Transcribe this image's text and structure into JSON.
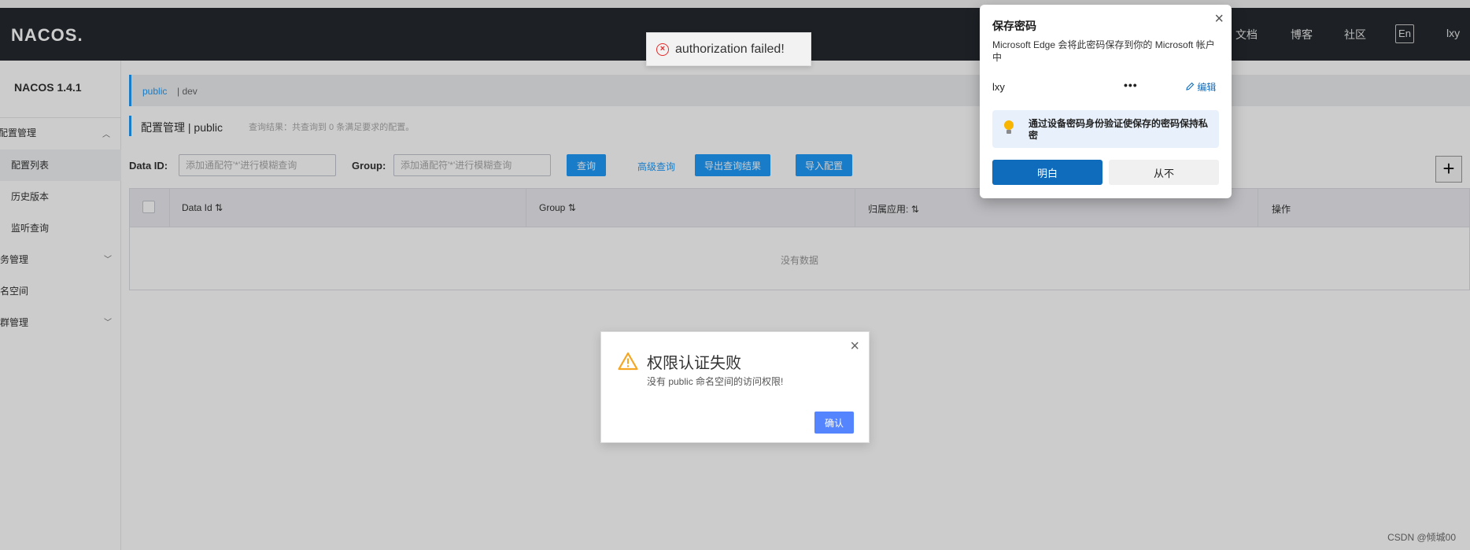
{
  "header": {
    "logo": "NACOS.",
    "nav": [
      "文档",
      "博客",
      "社区"
    ],
    "lang": "En",
    "user": "lxy"
  },
  "sidebar": {
    "title": "NACOS 1.4.1",
    "items": [
      {
        "label": "配置管理"
      },
      {
        "label": "配置列表"
      },
      {
        "label": "历史版本"
      },
      {
        "label": "监听查询"
      },
      {
        "label": "服务管理"
      },
      {
        "label": "命名空间"
      },
      {
        "label": "集群管理"
      }
    ]
  },
  "namespace": {
    "active": "public",
    "other": "| dev"
  },
  "page": {
    "title": "配置管理 | public",
    "query_tip": "查询结果：共查询到 0 条满足要求的配置。"
  },
  "filters": {
    "data_id_label": "Data ID:",
    "data_id_placeholder": "添加通配符'*'进行模糊查询",
    "group_label": "Group:",
    "group_placeholder": "添加通配符'*'进行模糊查询",
    "query_button": "查询",
    "advanced_query": "高级查询",
    "export_button": "导出查询结果",
    "import_button": "导入配置",
    "add_button": "+"
  },
  "table": {
    "columns": [
      "Data Id",
      "Group",
      "归属应用:",
      "操作"
    ],
    "sort_icon": "⇅",
    "empty": "没有数据"
  },
  "toast": {
    "message": "authorization failed!"
  },
  "dialog": {
    "title": "权限认证失败",
    "message": "没有 public 命名空间的访问权限!",
    "ok_button": "确认"
  },
  "edge_popup": {
    "title": "保存密码",
    "description": "Microsoft Edge 会将此密码保存到你的 Microsoft 帐户中",
    "username": "lxy",
    "password_mask": "•••",
    "edit": "编辑",
    "tip": "通过设备密码身份验证使保存的密码保持私密",
    "accept_button": "明白",
    "never_button": "从不"
  },
  "watermark": "CSDN @倾城00",
  "colors": {
    "header_bg": "#252a2f",
    "primary": "#209bfa",
    "dialog_button": "#5584ff",
    "edge_primary": "#0f6cbd",
    "error": "#e72b2b",
    "warning": "#f5a623"
  }
}
